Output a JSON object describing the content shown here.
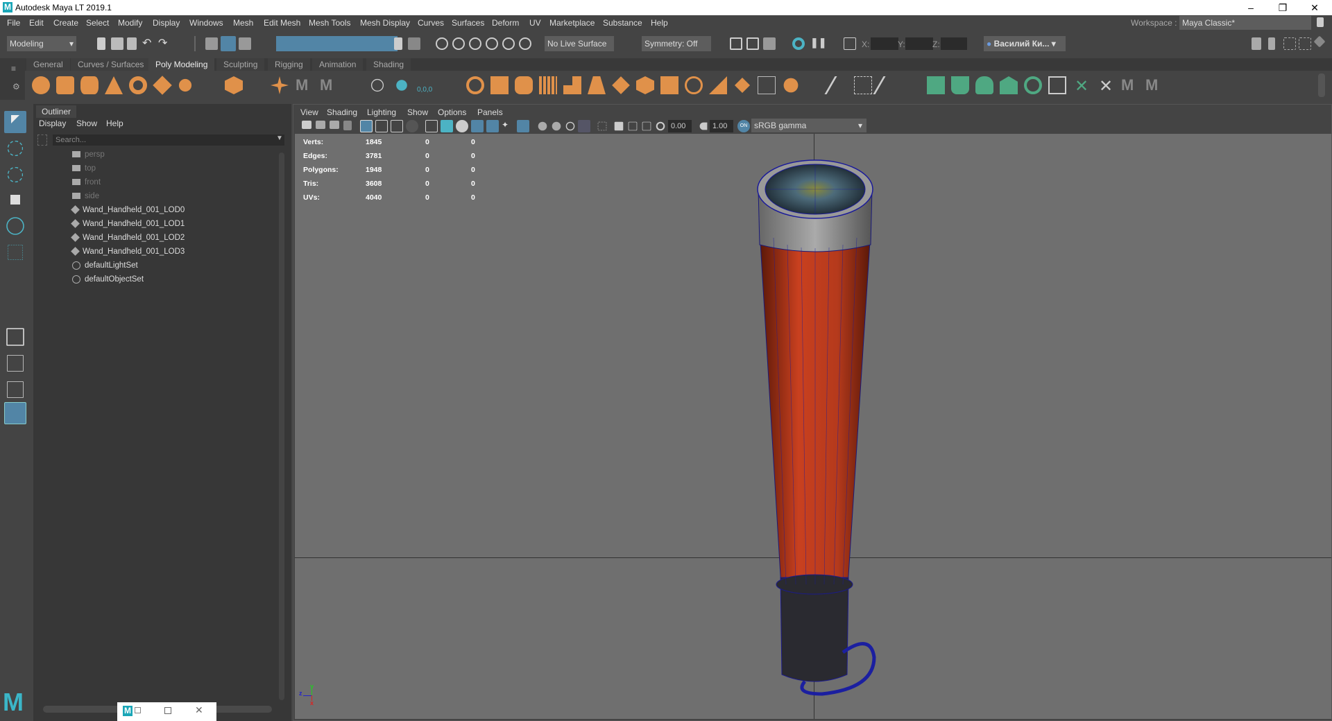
{
  "window": {
    "title": "Autodesk Maya LT 2019.1",
    "min": "–",
    "max": "❐",
    "close": "✕"
  },
  "menubar": [
    "File",
    "Edit",
    "Create",
    "Select",
    "Modify",
    "Display",
    "Windows",
    "Mesh",
    "Edit Mesh",
    "Mesh Tools",
    "Mesh Display",
    "Curves",
    "Surfaces",
    "Deform",
    "UV",
    "Marketplace",
    "Substance",
    "Help"
  ],
  "workspace": {
    "label": "Workspace :",
    "value": "Maya Classic*"
  },
  "status": {
    "menuset": "Modeling",
    "live_surface": "No Live Surface",
    "symmetry": "Symmetry: Off",
    "x_label": "X:",
    "y_label": "Y:",
    "z_label": "Z:",
    "user": "Василий Ки..."
  },
  "shelf_tabs": [
    "General",
    "Curves / Surfaces",
    "Poly Modeling",
    "Sculpting",
    "Rigging",
    "Animation",
    "Shading"
  ],
  "shelf_active": "Poly Modeling",
  "outliner": {
    "title": "Outliner",
    "menu": [
      "Display",
      "Show",
      "Help"
    ],
    "search_placeholder": "Search...",
    "items": [
      {
        "label": "persp",
        "type": "camera",
        "dim": true
      },
      {
        "label": "top",
        "type": "camera",
        "dim": true
      },
      {
        "label": "front",
        "type": "camera",
        "dim": true
      },
      {
        "label": "side",
        "type": "camera",
        "dim": true
      },
      {
        "label": "Wand_Handheld_001_LOD0",
        "type": "transform"
      },
      {
        "label": "Wand_Handheld_001_LOD1",
        "type": "transform"
      },
      {
        "label": "Wand_Handheld_001_LOD2",
        "type": "transform"
      },
      {
        "label": "Wand_Handheld_001_LOD3",
        "type": "transform"
      },
      {
        "label": "defaultLightSet",
        "type": "set"
      },
      {
        "label": "defaultObjectSet",
        "type": "set"
      }
    ]
  },
  "viewport": {
    "menu": [
      "View",
      "Shading",
      "Lighting",
      "Show",
      "Options",
      "Panels"
    ],
    "exposure": "0.00",
    "gamma": "1.00",
    "color_space": "sRGB gamma",
    "hud": [
      {
        "label": "Verts:",
        "v": [
          "1845",
          "0",
          "0"
        ]
      },
      {
        "label": "Edges:",
        "v": [
          "3781",
          "0",
          "0"
        ]
      },
      {
        "label": "Polygons:",
        "v": [
          "1948",
          "0",
          "0"
        ]
      },
      {
        "label": "Tris:",
        "v": [
          "3608",
          "0",
          "0"
        ]
      },
      {
        "label": "UVs:",
        "v": [
          "4040",
          "0",
          "0"
        ]
      }
    ],
    "axis": {
      "x": "x",
      "y": "y",
      "z": "z"
    }
  },
  "colors": {
    "accent": "#5285a6",
    "shelf_orange": "#e0914a",
    "shelf_green": "#4fa882",
    "wand_red": "#b83a1e"
  }
}
